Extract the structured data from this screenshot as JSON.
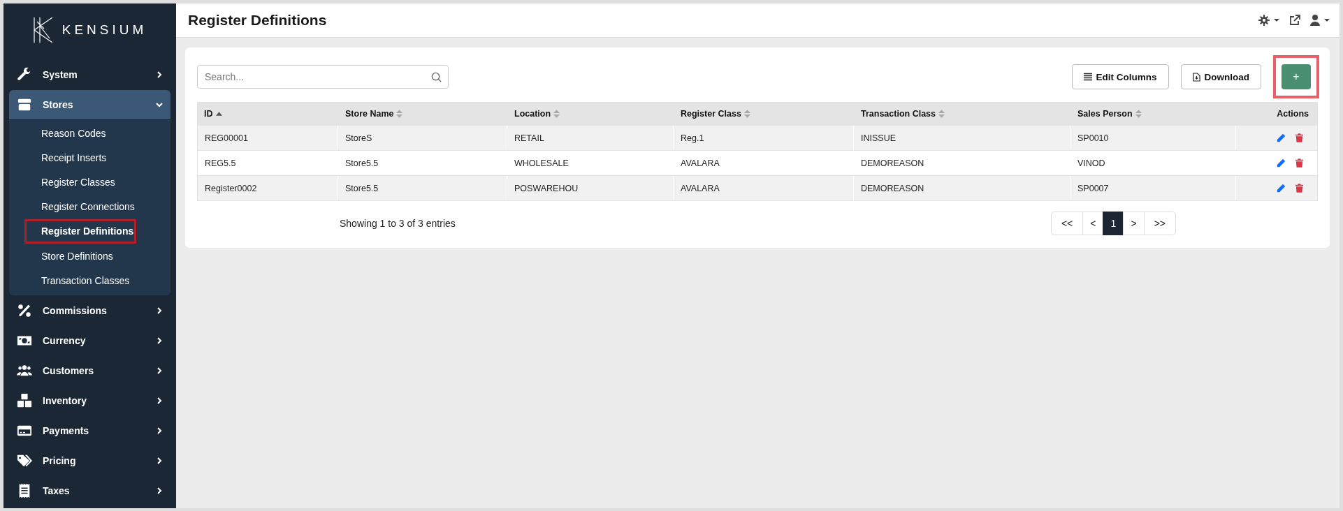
{
  "brand": {
    "name": "KENSIUM"
  },
  "sidebar": {
    "items": [
      {
        "label": "System",
        "expanded": false,
        "selected": false
      },
      {
        "label": "Stores",
        "expanded": true,
        "selected": true,
        "children": [
          {
            "label": "Reason Codes",
            "selected": false,
            "annotated": false
          },
          {
            "label": "Receipt Inserts",
            "selected": false,
            "annotated": false
          },
          {
            "label": "Register Classes",
            "selected": false,
            "annotated": false
          },
          {
            "label": "Register Connections",
            "selected": false,
            "annotated": false
          },
          {
            "label": "Register Definitions",
            "selected": true,
            "annotated": true
          },
          {
            "label": "Store Definitions",
            "selected": false,
            "annotated": false
          },
          {
            "label": "Transaction Classes",
            "selected": false,
            "annotated": false
          }
        ]
      },
      {
        "label": "Commissions",
        "expanded": false,
        "selected": false
      },
      {
        "label": "Currency",
        "expanded": false,
        "selected": false
      },
      {
        "label": "Customers",
        "expanded": false,
        "selected": false
      },
      {
        "label": "Inventory",
        "expanded": false,
        "selected": false
      },
      {
        "label": "Payments",
        "expanded": false,
        "selected": false
      },
      {
        "label": "Pricing",
        "expanded": false,
        "selected": false
      },
      {
        "label": "Taxes",
        "expanded": false,
        "selected": false
      }
    ]
  },
  "header": {
    "title": "Register Definitions"
  },
  "toolbar": {
    "search": {
      "placeholder": "Search..."
    },
    "edit_columns": "Edit Columns",
    "download": "Download",
    "add": {
      "label": "+",
      "annotated": true
    }
  },
  "table": {
    "columns": [
      {
        "label": "ID",
        "sortable": true,
        "sorted_ascending": true
      },
      {
        "label": "Store Name",
        "sortable": true,
        "sorted_ascending": false
      },
      {
        "label": "Location",
        "sortable": true,
        "sorted_ascending": false
      },
      {
        "label": "Register Class",
        "sortable": true,
        "sorted_ascending": false
      },
      {
        "label": "Transaction Class",
        "sortable": true,
        "sorted_ascending": false
      },
      {
        "label": "Sales Person",
        "sortable": true,
        "sorted_ascending": false
      },
      {
        "label": "Actions",
        "sortable": false
      }
    ],
    "rows": [
      [
        "REG00001",
        "StoreS",
        "RETAIL",
        "Reg.1",
        "INISSUE",
        "SP0010"
      ],
      [
        "REG5.5",
        "Store5.5",
        "WHOLESALE",
        "AVALARA",
        "DEMOREASON",
        "VINOD"
      ],
      [
        "Register0002",
        "Store5.5",
        "POSWAREHOU",
        "AVALARA",
        "DEMOREASON",
        "SP0007"
      ]
    ]
  },
  "footer": {
    "summary": "Showing 1 to 3 of 3 entries",
    "pagination": [
      {
        "label": "<<",
        "selected": false
      },
      {
        "label": "<",
        "selected": false
      },
      {
        "label": "1",
        "selected": true
      },
      {
        "label": ">",
        "selected": false
      },
      {
        "label": ">>",
        "selected": false
      }
    ]
  }
}
